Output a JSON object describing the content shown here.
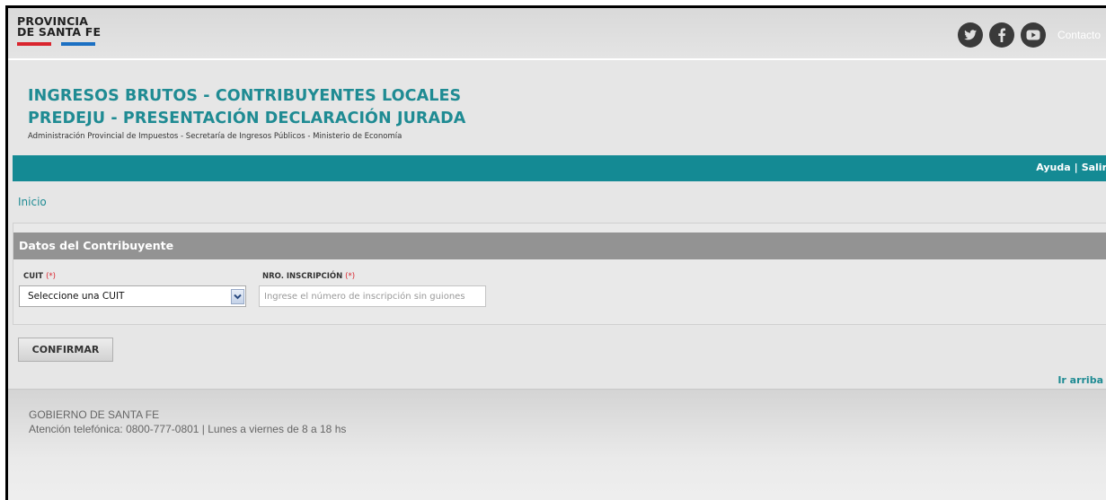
{
  "header": {
    "logo_line1": "PROVINCIA",
    "logo_line2": "DE SANTA FE",
    "logo_colors": {
      "red": "#d9252e",
      "blue": "#1c70c3"
    },
    "social_icons": [
      "twitter-icon",
      "facebook-icon",
      "youtube-icon"
    ],
    "contacto": "Contacto"
  },
  "titles": {
    "line1": "INGRESOS BRUTOS - CONTRIBUYENTES LOCALES",
    "line2": "PREDEJU - PRESENTACIÓN DECLARACIÓN JURADA",
    "subtitle": "Administración Provincial de Impuestos - Secretaría de Ingresos Públicos - Ministerio de Economía"
  },
  "nav": {
    "ayuda": "Ayuda",
    "separator": "|",
    "salir": "Salir",
    "inicio": "Inicio"
  },
  "form": {
    "section_title": "Datos del Contribuyente",
    "cuit_label": "CUIT",
    "required_mark": "(*)",
    "cuit_selected": "Seleccione una CUIT",
    "nro_label": "NRO. INSCRIPCIÓN",
    "nro_placeholder": "Ingrese el número de inscripción sin guiones",
    "nro_value": "",
    "confirm_label": "CONFIRMAR",
    "ir_arriba": "Ir arriba"
  },
  "footer": {
    "line1": "GOBIERNO DE SANTA FE",
    "line2": "Atención telefónica: 0800-777-0801 | Lunes a viernes de 8 a 18 hs"
  },
  "colors": {
    "teal": "#148a94",
    "title_teal": "#1f8b93",
    "panel_header": "#939393",
    "required": "#d9252e"
  }
}
